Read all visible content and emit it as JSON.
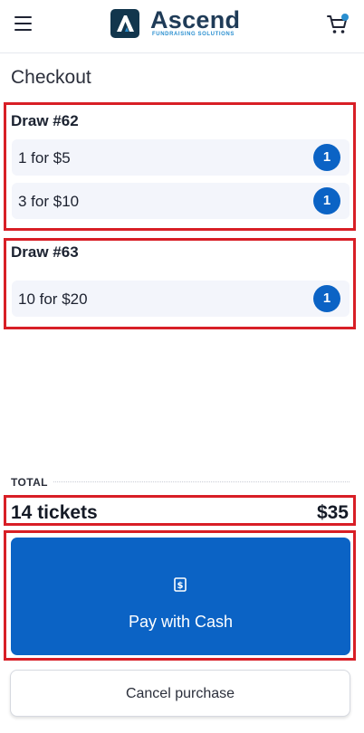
{
  "header": {
    "brand": "Ascend",
    "brand_sub": "FUNDRAISING SOLUTIONS",
    "menu_icon": "hamburger-icon",
    "cart_icon": "cart-icon",
    "accent": "#2a8fd0"
  },
  "page": {
    "title": "Checkout"
  },
  "draws": [
    {
      "title": "Draw #62",
      "items": [
        {
          "label": "1 for $5",
          "qty": "1"
        },
        {
          "label": "3 for $10",
          "qty": "1"
        }
      ]
    },
    {
      "title": "Draw #63",
      "items": [
        {
          "label": "10 for $20",
          "qty": "1"
        }
      ]
    }
  ],
  "total": {
    "label": "TOTAL",
    "tickets": "14 tickets",
    "amount": "$35"
  },
  "actions": {
    "pay_label": "Pay with Cash",
    "pay_icon": "cash-icon",
    "cancel_label": "Cancel purchase"
  },
  "colors": {
    "primary": "#0b63c5",
    "highlight": "#d81f26",
    "item_bg": "#f3f5fb"
  }
}
